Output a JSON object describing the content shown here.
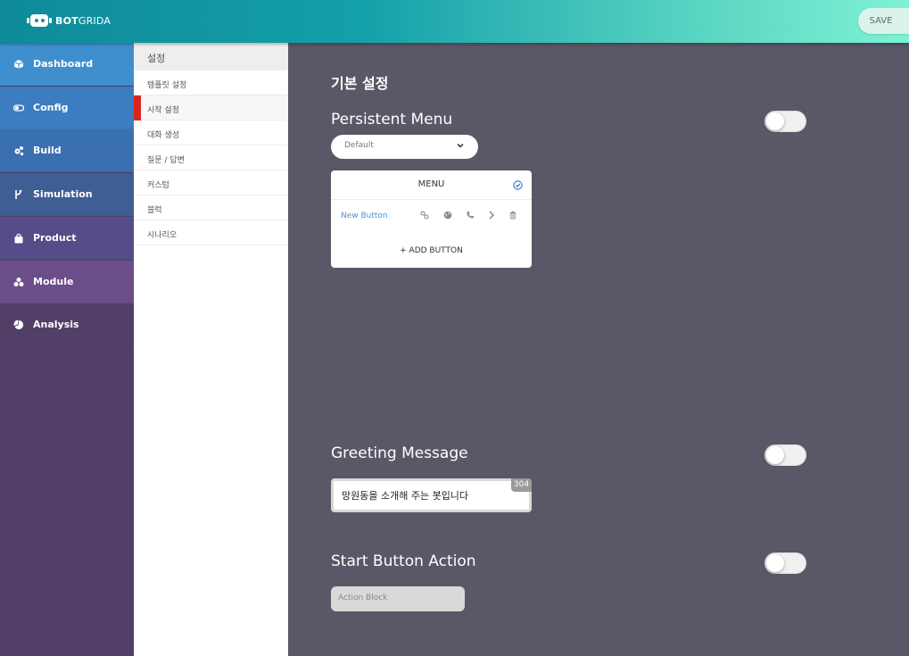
{
  "header": {
    "logo_bold": "BOT",
    "logo_light": "GRIDA",
    "save_label": "SAVE"
  },
  "sidebar": {
    "items": [
      {
        "label": "Dashboard",
        "icon": "cube-icon",
        "color": "#3f8fcf"
      },
      {
        "label": "Config",
        "icon": "toggle-icon",
        "color": "#3b7dc0"
      },
      {
        "label": "Build",
        "icon": "gears-icon",
        "color": "#3a6fb0"
      },
      {
        "label": "Simulation",
        "icon": "branch-icon",
        "color": "#3f5f94"
      },
      {
        "label": "Product",
        "icon": "bag-icon",
        "color": "#554c8a"
      },
      {
        "label": "Module",
        "icon": "cubes-icon",
        "color": "#6b4d8a"
      },
      {
        "label": "Analysis",
        "icon": "pie-chart-icon",
        "color": "#523f68"
      }
    ]
  },
  "submenu": {
    "title": "설정",
    "items": [
      {
        "label": "템플릿 설정",
        "active": false
      },
      {
        "label": "시작 설정",
        "active": true
      },
      {
        "label": "대화 생성",
        "active": false
      },
      {
        "label": "질문 / 답변",
        "active": false
      },
      {
        "label": "커스텀",
        "active": false
      },
      {
        "label": "블럭",
        "active": false
      },
      {
        "label": "시나리오",
        "active": false
      }
    ]
  },
  "main": {
    "page_title": "기본 설정",
    "persistent_menu": {
      "title": "Persistent Menu",
      "enabled": false,
      "dropdown_value": "Default",
      "card_title": "MENU",
      "button_label": "New Button",
      "button_icons": [
        "link-icon",
        "globe-icon",
        "phone-icon",
        "chevron-right-icon",
        "trash-icon"
      ],
      "add_label": "+ ADD BUTTON"
    },
    "greeting": {
      "title": "Greeting Message",
      "enabled": false,
      "text": "망원동을 소개해 주는 봇입니다",
      "char_count": "304"
    },
    "start_action": {
      "title": "Start Button Action",
      "enabled": false,
      "placeholder": "Action Block"
    }
  },
  "colors": {
    "accent_red": "#d9261c",
    "link_blue": "#4a8fd8",
    "main_bg": "#5a5766"
  }
}
